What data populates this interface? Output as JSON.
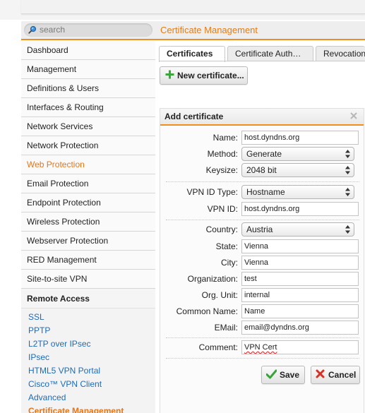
{
  "header": {
    "search_placeholder": "search",
    "page_title": "Certificate Management"
  },
  "sidebar": {
    "items": [
      {
        "label": "Dashboard"
      },
      {
        "label": "Management"
      },
      {
        "label": "Definitions & Users"
      },
      {
        "label": "Interfaces & Routing"
      },
      {
        "label": "Network Services"
      },
      {
        "label": "Network Protection"
      },
      {
        "label": "Web Protection",
        "active": true
      },
      {
        "label": "Email Protection"
      },
      {
        "label": "Endpoint Protection"
      },
      {
        "label": "Wireless Protection"
      },
      {
        "label": "Webserver Protection"
      },
      {
        "label": "RED Management"
      },
      {
        "label": "Site-to-site VPN"
      }
    ],
    "section": "Remote Access",
    "sub_items": [
      {
        "label": "SSL"
      },
      {
        "label": "PPTP"
      },
      {
        "label": "L2TP over IPsec"
      },
      {
        "label": "IPsec"
      },
      {
        "label": "HTML5 VPN Portal"
      },
      {
        "label": "Cisco™ VPN Client"
      },
      {
        "label": "Advanced"
      },
      {
        "label": "Certificate Management",
        "active": true
      }
    ]
  },
  "tabs": [
    {
      "label": "Certificates",
      "active": true
    },
    {
      "label": "Certificate Auth…"
    },
    {
      "label": "Revocation"
    }
  ],
  "toolbar": {
    "new_label": "New certificate..."
  },
  "form": {
    "title": "Add certificate",
    "name": {
      "label": "Name:",
      "value": "host.dyndns.org"
    },
    "method": {
      "label": "Method:",
      "value": "Generate"
    },
    "keysize": {
      "label": "Keysize:",
      "value": "2048 bit"
    },
    "vpn_id_type": {
      "label": "VPN ID Type:",
      "value": "Hostname"
    },
    "vpn_id": {
      "label": "VPN ID:",
      "value": "host.dyndns.org"
    },
    "country": {
      "label": "Country:",
      "value": "Austria"
    },
    "state": {
      "label": "State:",
      "value": "Vienna"
    },
    "city": {
      "label": "City:",
      "value": "Vienna"
    },
    "organization": {
      "label": "Organization:",
      "value": "test"
    },
    "org_unit": {
      "label": "Org. Unit:",
      "value": "internal"
    },
    "common_name": {
      "label": "Common Name:",
      "value": "Name"
    },
    "email": {
      "label": "EMail:",
      "value": "email@dyndns.org"
    },
    "comment": {
      "label": "Comment:",
      "value": "VPN Cert"
    },
    "save_label": "Save",
    "cancel_label": "Cancel"
  },
  "colors": {
    "accent": "#f08e1d",
    "link": "#1e6bb8",
    "active": "#e8751a"
  },
  "icons": [
    "search-icon",
    "plus-icon",
    "close-icon",
    "check-icon",
    "x-icon",
    "select-arrows-icon"
  ]
}
